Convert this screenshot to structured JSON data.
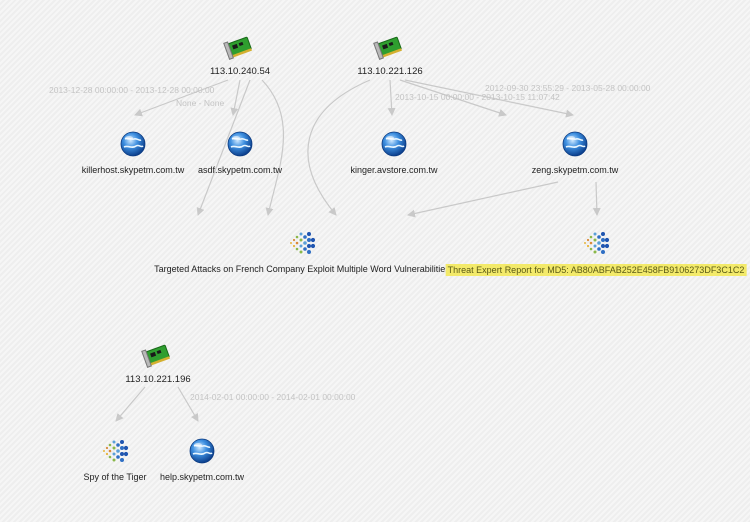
{
  "nodes": {
    "ip1": {
      "label": "113.10.240.54",
      "type": "ip"
    },
    "ip2": {
      "label": "113.10.221.126",
      "type": "ip"
    },
    "ip3": {
      "label": "113.10.221.196",
      "type": "ip"
    },
    "d1": {
      "label": "killerhost.skypetm.com.tw",
      "type": "domain"
    },
    "d2": {
      "label": "asdf.skypetm.com.tw",
      "type": "domain"
    },
    "d3": {
      "label": "kinger.avstore.com.tw",
      "type": "domain"
    },
    "d4": {
      "label": "zeng.skypetm.com.tw",
      "type": "domain"
    },
    "d5": {
      "label": "help.skypetm.com.tw",
      "type": "domain"
    },
    "r1": {
      "label": "Targeted Attacks on French Company Exploit Multiple Word Vulnerabilities",
      "type": "report"
    },
    "r2": {
      "label": "Threat Expert Report for MD5: AB80ABFAB252E458FB9106273DF3C1C2",
      "type": "report",
      "highlighted": true
    },
    "r3": {
      "label": "Spy of the Tiger",
      "type": "report"
    }
  },
  "edge_labels": {
    "e_ip1_d1": "2013-12-28 00:00:00 - 2013-12-28 00:00:00",
    "e_ip1_d2": "None - None",
    "e_ip2_d4": "2012-09-30 23:55:29 - 2013-05-28 00:00:00",
    "e_ip2_d3": "2013-10-15 00:00:00 - 2013-10-15 11:07:42",
    "e_ip3_d5": "2014-02-01 00:00:00 - 2014-02-01 00:00:00"
  },
  "colors": {
    "edge": "#c9c9c9",
    "highlight": "#f3ea6a"
  }
}
